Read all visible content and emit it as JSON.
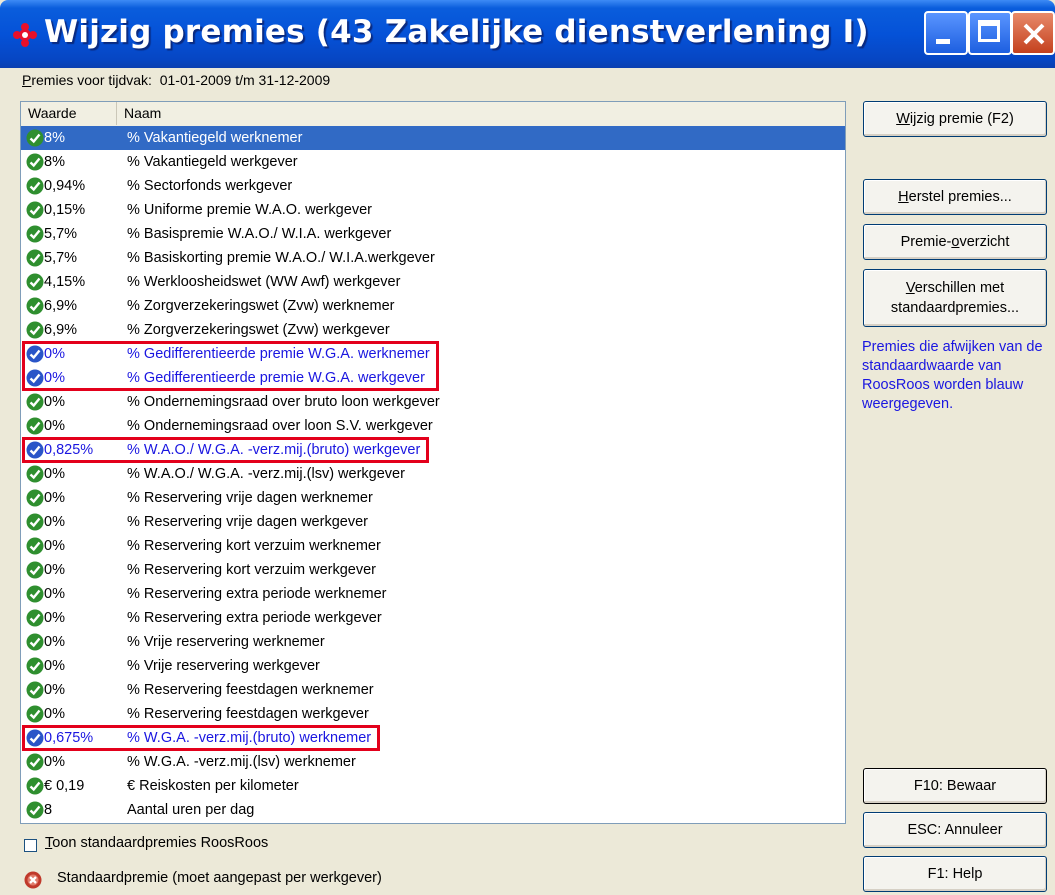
{
  "window": {
    "title": "Wijzig premies (43 Zakelijke dienstverlening I)"
  },
  "tijdvak": {
    "label_access": "P",
    "label_rest": "remies voor tijdvak:",
    "value": "01-01-2009 t/m 31-12-2009"
  },
  "list": {
    "columns": [
      "Waarde",
      "Naam"
    ],
    "rows": [
      {
        "value": "8%",
        "name": "% Vakantiegeld werknemer",
        "status": "default",
        "selected": true
      },
      {
        "value": "8%",
        "name": "% Vakantiegeld werkgever",
        "status": "default"
      },
      {
        "value": "0,94%",
        "name": "% Sectorfonds werkgever",
        "status": "default"
      },
      {
        "value": "0,15%",
        "name": "% Uniforme premie W.A.O. werkgever",
        "status": "default"
      },
      {
        "value": "5,7%",
        "name": "% Basispremie W.A.O./ W.I.A. werkgever",
        "status": "default"
      },
      {
        "value": "5,7%",
        "name": "% Basiskorting premie W.A.O./ W.I.A.werkgever",
        "status": "default"
      },
      {
        "value": "4,15%",
        "name": "% Werkloosheidswet (WW Awf) werkgever",
        "status": "default"
      },
      {
        "value": "6,9%",
        "name": "% Zorgverzekeringswet (Zvw) werknemer",
        "status": "default"
      },
      {
        "value": "6,9%",
        "name": "% Zorgverzekeringswet (Zvw) werkgever",
        "status": "default"
      },
      {
        "value": "0%",
        "name": "% Gedifferentieerde premie W.G.A. werknemer",
        "status": "custom"
      },
      {
        "value": "0%",
        "name": "% Gedifferentieerde premie W.G.A. werkgever",
        "status": "custom"
      },
      {
        "value": "0%",
        "name": "% Ondernemingsraad over bruto loon werkgever",
        "status": "default"
      },
      {
        "value": "0%",
        "name": "% Ondernemingsraad over loon S.V. werkgever",
        "status": "default"
      },
      {
        "value": "0,825%",
        "name": "% W.A.O./ W.G.A. -verz.mij.(bruto) werkgever",
        "status": "custom"
      },
      {
        "value": "0%",
        "name": "% W.A.O./ W.G.A. -verz.mij.(lsv) werkgever",
        "status": "default"
      },
      {
        "value": "0%",
        "name": "% Reservering vrije dagen werknemer",
        "status": "default"
      },
      {
        "value": "0%",
        "name": "% Reservering vrije dagen werkgever",
        "status": "default"
      },
      {
        "value": "0%",
        "name": "% Reservering kort verzuim werknemer",
        "status": "default"
      },
      {
        "value": "0%",
        "name": "% Reservering kort verzuim werkgever",
        "status": "default"
      },
      {
        "value": "0%",
        "name": "% Reservering extra periode werknemer",
        "status": "default"
      },
      {
        "value": "0%",
        "name": "% Reservering extra periode werkgever",
        "status": "default"
      },
      {
        "value": "0%",
        "name": "% Vrije reservering werknemer",
        "status": "default"
      },
      {
        "value": "0%",
        "name": "% Vrije reservering werkgever",
        "status": "default"
      },
      {
        "value": "0%",
        "name": "% Reservering feestdagen werknemer",
        "status": "default"
      },
      {
        "value": "0%",
        "name": "% Reservering feestdagen werkgever",
        "status": "default"
      },
      {
        "value": "0,675%",
        "name": "% W.G.A. -verz.mij.(bruto) werknemer",
        "status": "custom"
      },
      {
        "value": "0%",
        "name": "% W.G.A. -verz.mij.(lsv) werknemer",
        "status": "default"
      },
      {
        "value": "€ 0,19",
        "name": "€ Reiskosten per kilometer",
        "status": "default"
      },
      {
        "value": "8",
        "name": "Aantal uren per dag",
        "status": "default"
      }
    ],
    "highlighted_rows": [
      9,
      10,
      13,
      25
    ]
  },
  "buttons": {
    "wijzig": {
      "access": "W",
      "rest": "ijzig premie (F2)"
    },
    "herstel": {
      "access": "H",
      "rest": "erstel premies..."
    },
    "overzicht": {
      "pre": "Premie-",
      "access": "o",
      "rest": "verzicht"
    },
    "verschil_1": {
      "access": "V",
      "rest": "erschillen met"
    },
    "verschil_2": "standaardpremies...",
    "bewaar": "F10: Bewaar",
    "annuleer": "ESC: Annuleer",
    "help": "F1: Help"
  },
  "info_text": "Premies die afwijken van de standaardwaarde van RoosRoos worden blauw weergegeven.",
  "checkbox": {
    "access": "T",
    "rest": "oon standaardpremies RoosRoos",
    "checked": false
  },
  "legend": {
    "text": "Standaardpremie (moet aangepast per werkgever)"
  },
  "colors": {
    "custom_text": "#1a16e0",
    "selection": "#316ac5",
    "highlight_box": "#e3001b",
    "default_icon": "#2f8f2f",
    "custom_icon": "#2a55c8",
    "warning_icon": "#c0392b"
  },
  "icons": {
    "default": "green-check-icon",
    "custom": "blue-check-icon",
    "legend": "red-x-icon"
  }
}
